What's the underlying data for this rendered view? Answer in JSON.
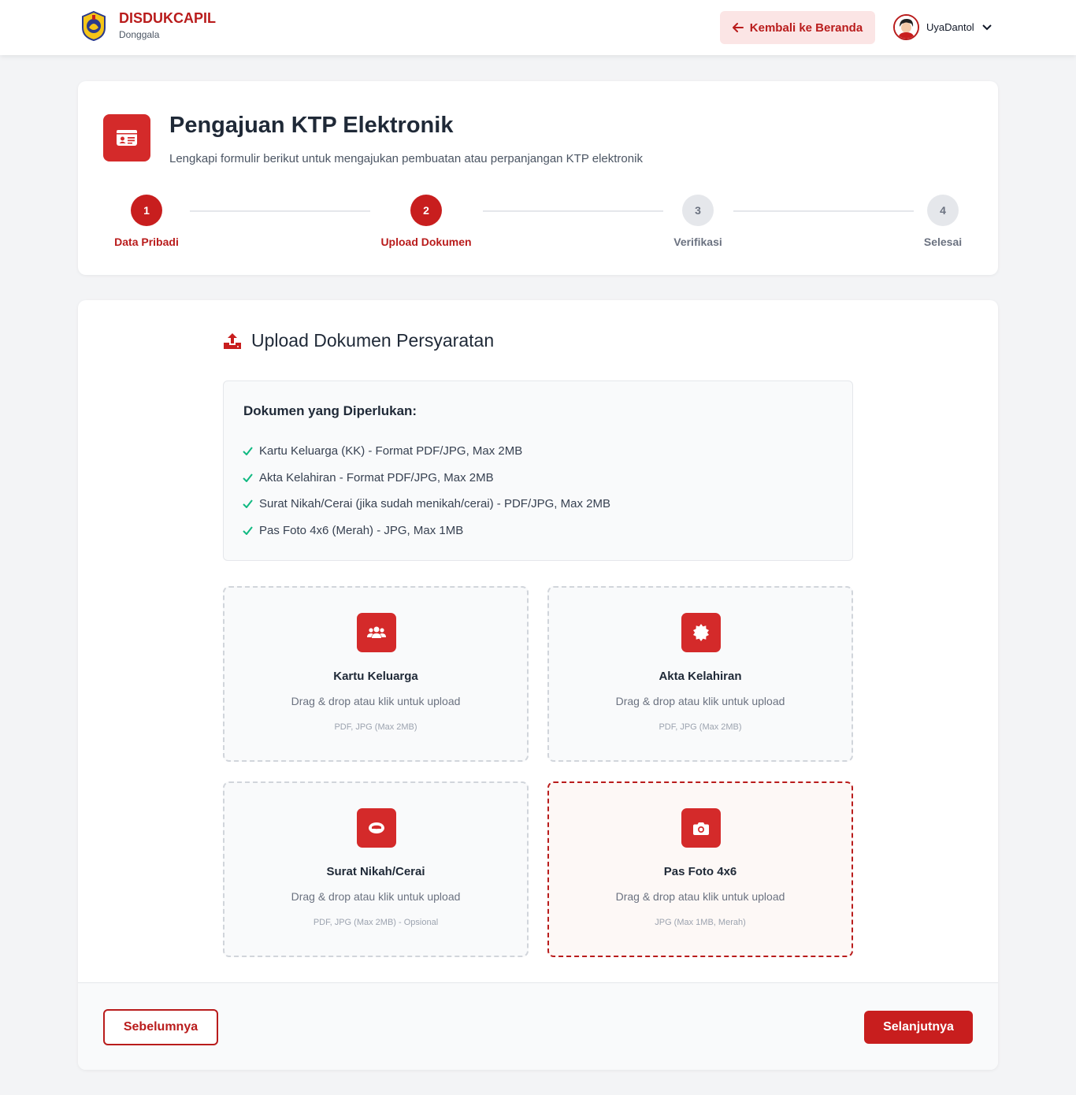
{
  "header": {
    "brand_title": "DISDUKCAPIL",
    "brand_subtitle": "Donggala",
    "back_label": "Kembali ke Beranda",
    "user_name": "UyaDantol"
  },
  "page": {
    "title": "Pengajuan KTP Elektronik",
    "subtitle": "Lengkapi formulir berikut untuk mengajukan pembuatan atau perpanjangan KTP elektronik"
  },
  "steps": [
    {
      "number": "1",
      "label": "Data Pribadi",
      "state": "active"
    },
    {
      "number": "2",
      "label": "Upload Dokumen",
      "state": "active"
    },
    {
      "number": "3",
      "label": "Verifikasi",
      "state": "inactive"
    },
    {
      "number": "4",
      "label": "Selesai",
      "state": "inactive"
    }
  ],
  "upload_section": {
    "title": "Upload Dokumen Persyaratan",
    "requirements_title": "Dokumen yang Diperlukan:",
    "requirements": [
      "Kartu Keluarga (KK) - Format PDF/JPG, Max 2MB",
      "Akta Kelahiran - Format PDF/JPG, Max 2MB",
      "Surat Nikah/Cerai (jika sudah menikah/cerai) - PDF/JPG, Max 2MB",
      "Pas Foto 4x6 (Merah) - JPG, Max 1MB"
    ],
    "uploads": [
      {
        "title": "Kartu Keluarga",
        "hint": "Drag & drop atau klik untuk upload",
        "format": "PDF, JPG (Max 2MB)",
        "icon": "users-icon"
      },
      {
        "title": "Akta Kelahiran",
        "hint": "Drag & drop atau klik untuk upload",
        "format": "PDF, JPG (Max 2MB)",
        "icon": "certificate-icon"
      },
      {
        "title": "Surat Nikah/Cerai",
        "hint": "Drag & drop atau klik untuk upload",
        "format": "PDF, JPG (Max 2MB) - Opsional",
        "icon": "rings-icon"
      },
      {
        "title": "Pas Foto 4x6",
        "hint": "Drag & drop atau klik untuk upload",
        "format": "JPG (Max 1MB, Merah)",
        "icon": "camera-icon"
      }
    ]
  },
  "footer": {
    "prev_label": "Sebelumnya",
    "next_label": "Selanjutnya"
  },
  "colors": {
    "brand": "#b91c1c",
    "accent": "#d42a2a",
    "check": "#10b981",
    "muted": "#e5e7eb"
  }
}
